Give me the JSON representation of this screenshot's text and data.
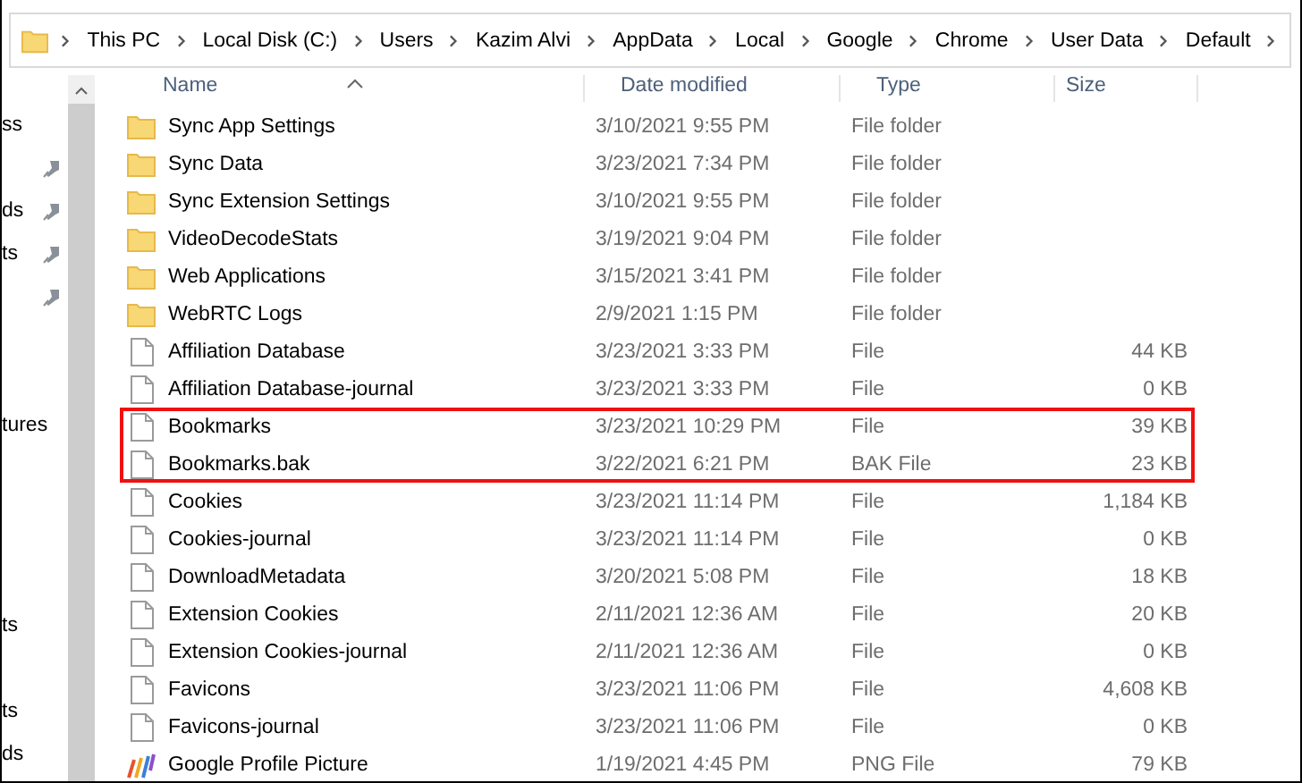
{
  "breadcrumb": [
    "This PC",
    "Local Disk (C:)",
    "Users",
    "Kazim Alvi",
    "AppData",
    "Local",
    "Google",
    "Chrome",
    "User Data",
    "Default"
  ],
  "nav_pane": [
    {
      "items": [
        {
          "label": "ss",
          "pinned": false
        },
        {
          "pinned": true
        },
        {
          "label": "ds",
          "pinned": true
        },
        {
          "label": "ts",
          "pinned": true
        },
        {
          "pinned": true
        }
      ]
    },
    {
      "items": [
        {
          "label": "tures",
          "pinned": false
        }
      ]
    },
    {
      "items": [
        {
          "label": "ts",
          "pinned": false
        }
      ]
    },
    {
      "items": [
        {
          "label": "ts",
          "pinned": false
        },
        {
          "label": "ds",
          "pinned": false
        }
      ]
    }
  ],
  "columns": [
    "Name",
    "Date modified",
    "Type",
    "Size"
  ],
  "rows": [
    {
      "kind": "folder",
      "name": "Sync App Settings",
      "date": "3/10/2021 9:55 PM",
      "type": "File folder",
      "highlighted": false
    },
    {
      "kind": "folder",
      "name": "Sync Data",
      "date": "3/23/2021 7:34 PM",
      "type": "File folder",
      "highlighted": false
    },
    {
      "kind": "folder",
      "name": "Sync Extension Settings",
      "date": "3/10/2021 9:55 PM",
      "type": "File folder",
      "highlighted": false
    },
    {
      "kind": "folder",
      "name": "VideoDecodeStats",
      "date": "3/19/2021 9:04 PM",
      "type": "File folder",
      "highlighted": false
    },
    {
      "kind": "folder",
      "name": "Web Applications",
      "date": "3/15/2021 3:41 PM",
      "type": "File folder",
      "highlighted": false
    },
    {
      "kind": "folder",
      "name": "WebRTC Logs",
      "date": "2/9/2021 1:15 PM",
      "type": "File folder",
      "highlighted": false
    },
    {
      "kind": "file",
      "name": "Affiliation Database",
      "date": "3/23/2021 3:33 PM",
      "type": "File",
      "size": "44 KB",
      "highlighted": false
    },
    {
      "kind": "file",
      "name": "Affiliation Database-journal",
      "date": "3/23/2021 3:33 PM",
      "type": "File",
      "size": "0 KB",
      "highlighted": false
    },
    {
      "kind": "file",
      "name": "Bookmarks",
      "date": "3/23/2021 10:29 PM",
      "type": "File",
      "size": "39 KB",
      "highlighted": true
    },
    {
      "kind": "file",
      "name": "Bookmarks.bak",
      "date": "3/22/2021 6:21 PM",
      "type": "BAK File",
      "size": "23 KB",
      "highlighted": true
    },
    {
      "kind": "file",
      "name": "Cookies",
      "date": "3/23/2021 11:14 PM",
      "type": "File",
      "size": "1,184 KB",
      "highlighted": false
    },
    {
      "kind": "file",
      "name": "Cookies-journal",
      "date": "3/23/2021 11:14 PM",
      "type": "File",
      "size": "0 KB",
      "highlighted": false
    },
    {
      "kind": "file",
      "name": "DownloadMetadata",
      "date": "3/20/2021 5:08 PM",
      "type": "File",
      "size": "18 KB",
      "highlighted": false
    },
    {
      "kind": "file",
      "name": "Extension Cookies",
      "date": "2/11/2021 12:36 AM",
      "type": "File",
      "size": "20 KB",
      "highlighted": false
    },
    {
      "kind": "file",
      "name": "Extension Cookies-journal",
      "date": "2/11/2021 12:36 AM",
      "type": "File",
      "size": "0 KB",
      "highlighted": false
    },
    {
      "kind": "file",
      "name": "Favicons",
      "date": "3/23/2021 11:06 PM",
      "type": "File",
      "size": "4,608 KB",
      "highlighted": false
    },
    {
      "kind": "file",
      "name": "Favicons-journal",
      "date": "3/23/2021 11:06 PM",
      "type": "File",
      "size": "0 KB",
      "highlighted": false
    },
    {
      "kind": "image",
      "name": "Google Profile Picture",
      "date": "1/19/2021 4:45 PM",
      "type": "PNG File",
      "size": "79 KB",
      "highlighted": false
    }
  ]
}
